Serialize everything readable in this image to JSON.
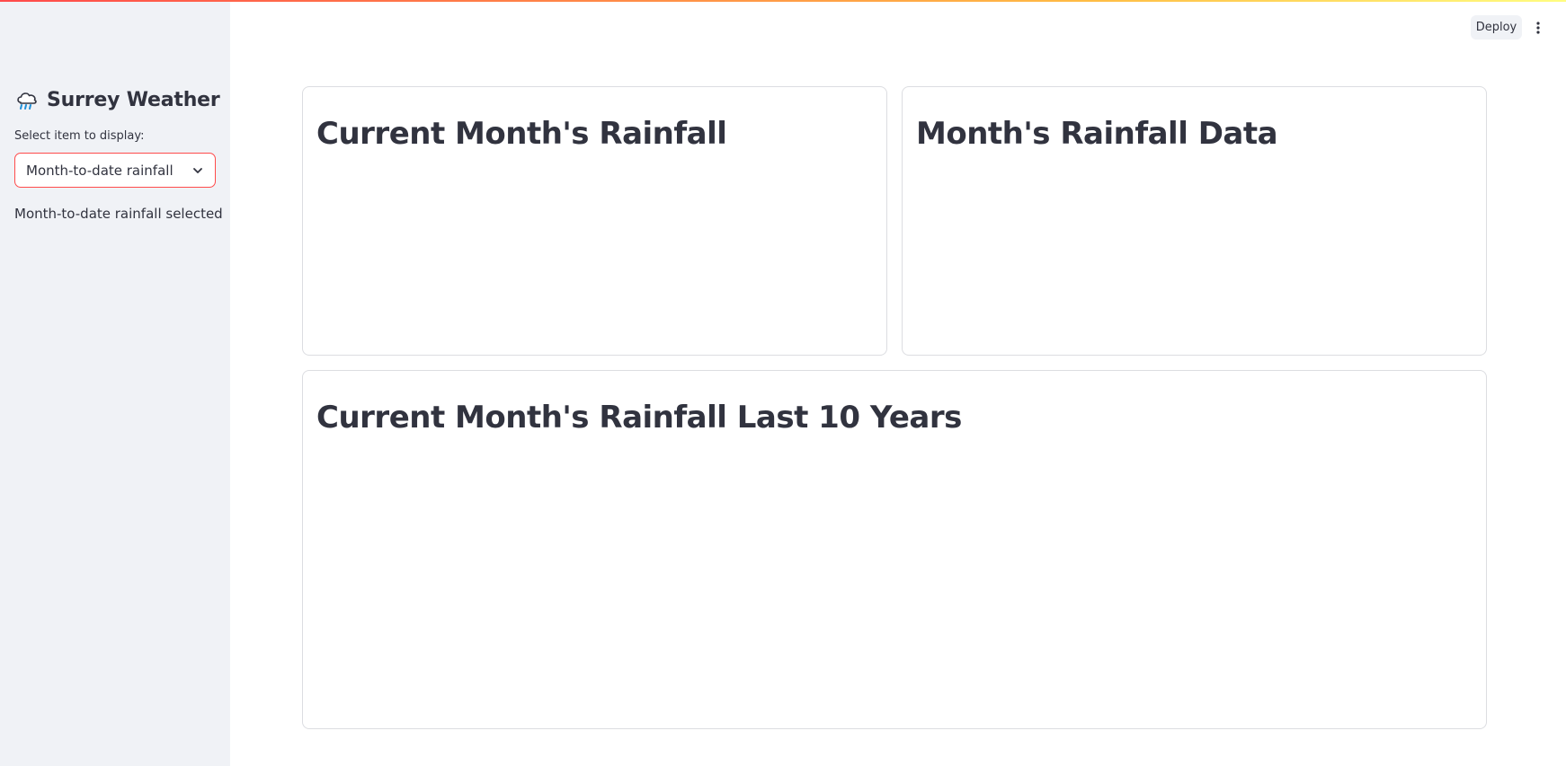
{
  "sidebar": {
    "brand": {
      "icon": "rain-cloud-icon",
      "title": "Surrey Weather"
    },
    "select": {
      "label": "Select item to display:",
      "value": "Month-to-date rainfall",
      "icon": "chevron-down-icon"
    },
    "status_text": "Month-to-date rainfall selected"
  },
  "header": {
    "deploy_label": "Deploy",
    "menu_icon": "vertical-ellipsis-icon"
  },
  "main": {
    "cards": [
      {
        "title": "Current Month's Rainfall"
      },
      {
        "title": "Month's Rainfall Data"
      },
      {
        "title": "Current Month's Rainfall Last 10 Years"
      }
    ]
  },
  "colors": {
    "accent": "#ff4b4b",
    "sidebar_bg": "#f0f2f6",
    "text": "#31333f",
    "card_border": "#dcdde1"
  }
}
